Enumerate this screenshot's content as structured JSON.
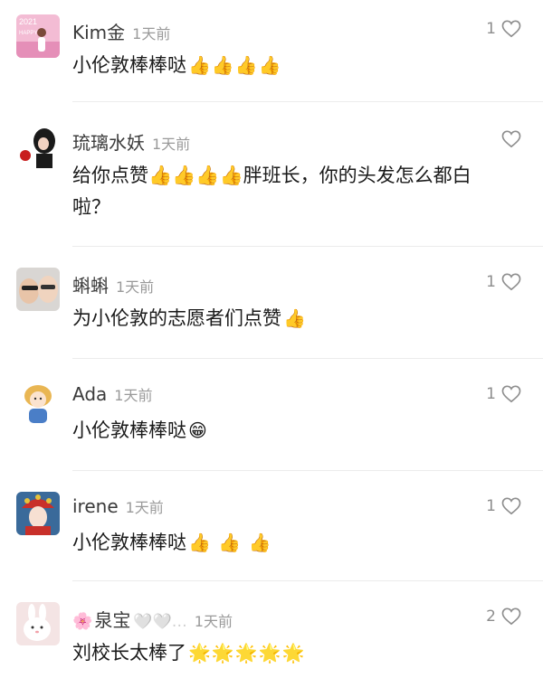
{
  "comments": [
    {
      "name": "Kim金",
      "time": "1天前",
      "text": "小伦敦棒棒哒",
      "emojis": "👍👍👍👍",
      "likes": "1",
      "avatar": "new-year-photo"
    },
    {
      "name": "琉璃水妖",
      "time": "1天前",
      "text": "给你点赞👍👍👍👍胖班长，你的头发怎么都白啦？",
      "emojis": "",
      "likes": "",
      "avatar": "woman-with-rose"
    },
    {
      "name": "蝌蝌",
      "time": "1天前",
      "text": "为小伦敦的志愿者们点赞",
      "emojis": "👍",
      "likes": "1",
      "avatar": "couple-selfie"
    },
    {
      "name": "Ada",
      "time": "1天前",
      "text": "小伦敦棒棒哒",
      "emojis": "😁",
      "likes": "1",
      "avatar": "cartoon-girl"
    },
    {
      "name": "irene",
      "time": "1天前",
      "text": "小伦敦棒棒哒",
      "emojis": "👍 👍 👍",
      "likes": "1",
      "avatar": "opera-costume"
    },
    {
      "name": "泉宝",
      "name_prefix": "🌸",
      "name_suffix": "🤍🤍…",
      "time": "1天前",
      "text": "刘校长太棒了",
      "emojis": "🌟🌟🌟🌟🌟",
      "likes": "2",
      "avatar": "rabbit-toy"
    }
  ]
}
